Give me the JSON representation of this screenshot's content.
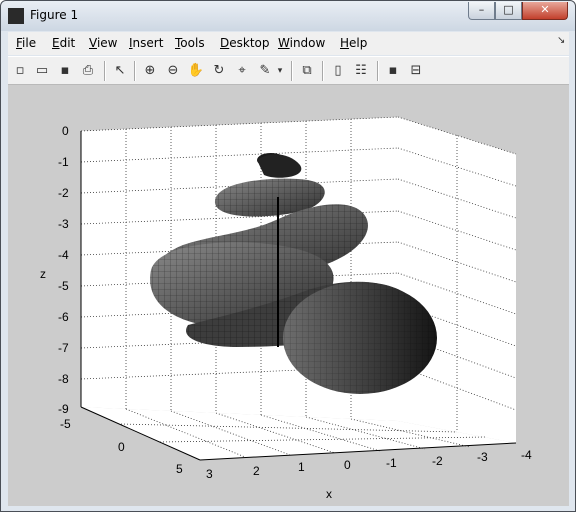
{
  "window": {
    "title": "Figure 1",
    "minimize": "–",
    "maximize": "□",
    "close": "✕"
  },
  "menu": [
    "File",
    "Edit",
    "View",
    "Insert",
    "Tools",
    "Desktop",
    "Window",
    "Help"
  ],
  "toolbar_icons": [
    "new-figure-icon",
    "open-file-icon",
    "save-icon",
    "print-icon",
    "edit-plot-icon",
    "zoom-in-icon",
    "zoom-out-icon",
    "pan-icon",
    "rotate-3d-icon",
    "data-cursor-icon",
    "brush-icon",
    "link-plot-icon",
    "colorbar-icon",
    "legend-icon",
    "hide-plot-tools-icon",
    "show-plot-tools-icon"
  ],
  "chart_data": {
    "type": "surface",
    "title": "",
    "xlabel": "x",
    "ylabel": "",
    "zlabel": "z",
    "x_ticks": [
      "3",
      "2",
      "1",
      "0",
      "-1",
      "-2",
      "-3",
      "-4"
    ],
    "y_ticks": [
      "-5",
      "0",
      "5"
    ],
    "z_ticks": [
      "0",
      "-1",
      "-2",
      "-3",
      "-4",
      "-5",
      "-6",
      "-7",
      "-8",
      "-9"
    ],
    "xlim": [
      -4,
      3
    ],
    "ylim": [
      -5,
      5
    ],
    "zlim": [
      -9,
      0
    ],
    "grid": true,
    "colormap": "gray",
    "description_shape": "helical tube spiraling downward, radius growing with depth"
  }
}
